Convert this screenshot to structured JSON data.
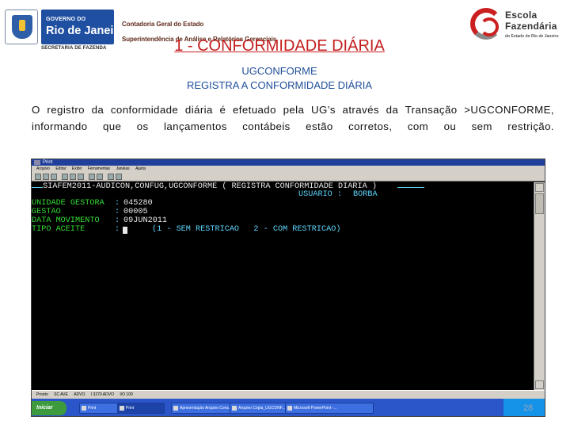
{
  "header": {
    "gov_line_small": "GOVERNO DO",
    "gov_line_big": "Rio de Janeiro",
    "gov_secretaria": "SECRETARIA DE FAZENDA",
    "contadoria": "Contadoria Geral do Estado",
    "superintendencia": "Superintendência de Análise e Relatórios Gerenciais",
    "escola_line1": "Escola",
    "escola_line2": "Fazendária",
    "escola_line3": "do Estado do Rio de Janeiro"
  },
  "slide": {
    "title": "1 - CONFORMIDADE DIÁRIA",
    "subtitle1": "UGCONFORME",
    "subtitle2": "REGISTRA A CONFORMIDADE DIÁRIA",
    "body": "O registro da conformidade diária é efetuado pela UG’s através da Transação >UGCONFORME, informando que os lançamentos contábeis estão corretos, com ou sem restrição.",
    "page_number": "28"
  },
  "window": {
    "title": "Print",
    "menu": [
      "Arquivo",
      "Editar",
      "Exibir",
      "Ferramentas",
      "Janelas",
      "Ajuda"
    ]
  },
  "terminal": {
    "header_line": " SIAFEM2011-AUDICON,CONFUG,UGCONFORME ( REGISTRA CONFORMIDADE DIARIA )",
    "usuario_label": "USUARIO :",
    "usuario_value": "BORBA",
    "fields": [
      {
        "label": "UNIDADE GESTORA",
        "sep": ":",
        "value": "045280"
      },
      {
        "label": "GESTAO",
        "sep": ":",
        "value": "00005"
      },
      {
        "label": "DATA MOVIMENTO",
        "sep": ":",
        "value": "09JUN2011"
      },
      {
        "label": "TIPO ACEITE",
        "sep": ":",
        "value": ""
      }
    ],
    "options_hint": "(1 - SEM RESTRICAO   2 - COM RESTRICAO)"
  },
  "statusbar": [
    "Pronto",
    "SC  AVE",
    "ADVO",
    "I 3270 ADVO",
    "I/O  100"
  ],
  "taskbar": {
    "start_label": "Iniciar",
    "tasks": [
      "Print",
      "Print",
      "Apresentação Arquivo Cons...",
      "Arquivo Cópia_UGCONF...",
      "Microsoft PowerPoint -..."
    ]
  },
  "colors": {
    "title_red": "#c41e1e",
    "subtitle_blue": "#1f4e9a",
    "terminal_green": "#33dd33",
    "terminal_cyan": "#5fd7ff",
    "taskbar_blue": "#2b56c9"
  }
}
